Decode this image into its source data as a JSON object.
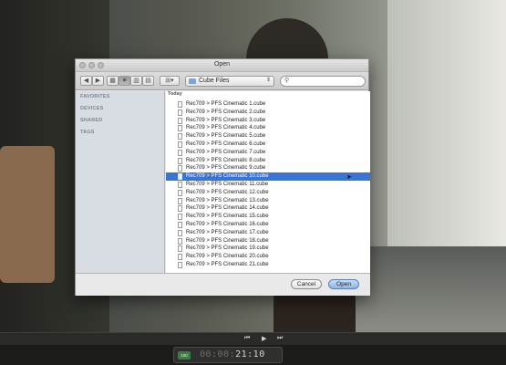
{
  "dialog": {
    "title": "Open",
    "path_label": "Cube Files",
    "search_placeholder": "",
    "sidebar": {
      "sections": [
        "FAVORITES",
        "DEVICES",
        "SHARED",
        "TAGS"
      ]
    },
    "list_header": "Today",
    "files": [
      "Rec709 > PFS Cinematic 1.cube",
      "Rec709 > PFS Cinematic 2.cube",
      "Rec709 > PFS Cinematic 3.cube",
      "Rec709 > PFS Cinematic 4.cube",
      "Rec709 > PFS Cinematic 5.cube",
      "Rec709 > PFS Cinematic 6.cube",
      "Rec709 > PFS Cinematic 7.cube",
      "Rec709 > PFS Cinematic 8.cube",
      "Rec709 > PFS Cinematic 9.cube",
      "Rec709 > PFS Cinematic 10.cube",
      "Rec709 > PFS Cinematic 11.cube",
      "Rec709 > PFS Cinematic 12.cube",
      "Rec709 > PFS Cinematic 13.cube",
      "Rec709 > PFS Cinematic 14.cube",
      "Rec709 > PFS Cinematic 15.cube",
      "Rec709 > PFS Cinematic 16.cube",
      "Rec709 > PFS Cinematic 17.cube",
      "Rec709 > PFS Cinematic 18.cube",
      "Rec709 > PFS Cinematic 19.cube",
      "Rec709 > PFS Cinematic 20.cube",
      "Rec709 > PFS Cinematic 21.cube"
    ],
    "selected_file": "Rec709 > PFS Cinematic 10.cube",
    "cancel_label": "Cancel",
    "open_label": "Open"
  },
  "player": {
    "timecode_dim": "00:00:",
    "timecode": "21:10",
    "badge": "100"
  },
  "colors": {
    "selection": "#3875d7",
    "sidebar_bg": "#d8dde4"
  }
}
